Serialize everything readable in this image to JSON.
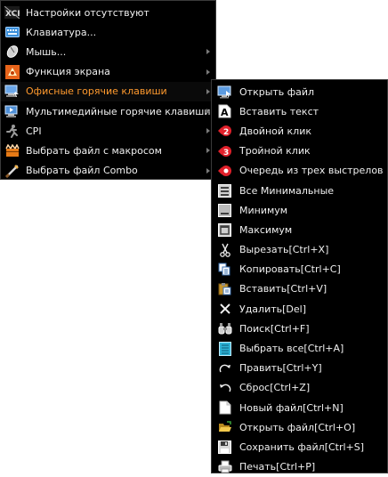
{
  "main_menu": {
    "items": [
      {
        "label": "Настройки отсутствуют",
        "icon": "no-config-icon",
        "submenu": false,
        "active": false
      },
      {
        "label": "Клавиатура...",
        "icon": "keyboard-icon",
        "submenu": false,
        "active": false
      },
      {
        "label": "Мышь...",
        "icon": "mouse-icon",
        "submenu": true,
        "active": false
      },
      {
        "label": "Функция экрана",
        "icon": "screen-function-icon",
        "submenu": true,
        "active": false
      },
      {
        "label": "Офисные горячие клавиши",
        "icon": "office-hotkeys-icon",
        "submenu": true,
        "active": true
      },
      {
        "label": "Мультимедийные горячие клавиши",
        "icon": "multimedia-hotkeys-icon",
        "submenu": true,
        "active": false
      },
      {
        "label": "CPI",
        "icon": "cpi-icon",
        "submenu": true,
        "active": false
      },
      {
        "label": "Выбрать файл с макросом",
        "icon": "macro-file-icon",
        "submenu": true,
        "active": false
      },
      {
        "label": "Выбрать файл Combo",
        "icon": "combo-file-icon",
        "submenu": true,
        "active": false
      }
    ]
  },
  "sub_menu": {
    "items": [
      {
        "label": "Открыть файл",
        "icon": "open-file-icon"
      },
      {
        "label": "Вставить текст",
        "icon": "insert-text-icon"
      },
      {
        "label": "Двойной клик",
        "icon": "double-click-icon"
      },
      {
        "label": "Тройной клик",
        "icon": "triple-click-icon"
      },
      {
        "label": "Очередь из трех выстрелов",
        "icon": "three-shot-burst-icon"
      },
      {
        "label": "Все Минимальные",
        "icon": "minimize-all-icon"
      },
      {
        "label": "Минимум",
        "icon": "minimize-icon"
      },
      {
        "label": "Максимум",
        "icon": "maximize-icon"
      },
      {
        "label": "Вырезать[Ctrl+X]",
        "icon": "cut-icon"
      },
      {
        "label": "Копировать[Ctrl+C]",
        "icon": "copy-icon"
      },
      {
        "label": "Вставить[Ctrl+V]",
        "icon": "paste-icon"
      },
      {
        "label": "Удалить[Del]",
        "icon": "delete-icon"
      },
      {
        "label": "Поиск[Ctrl+F]",
        "icon": "find-icon"
      },
      {
        "label": "Выбрать все[Ctrl+A]",
        "icon": "select-all-icon"
      },
      {
        "label": "Править[Ctrl+Y]",
        "icon": "redo-icon"
      },
      {
        "label": "Сброс[Ctrl+Z]",
        "icon": "undo-icon"
      },
      {
        "label": "Новый файл[Ctrl+N]",
        "icon": "new-file-icon"
      },
      {
        "label": "Открыть файл[Ctrl+O]",
        "icon": "open-folder-icon"
      },
      {
        "label": "Сохранить файл[Ctrl+S]",
        "icon": "save-file-icon"
      },
      {
        "label": "Печать[Ctrl+P]",
        "icon": "print-icon"
      }
    ]
  },
  "colors": {
    "menu_background": "#000000",
    "text": "#f0f0f0",
    "highlight_text": "#ff9a2e",
    "click_badge": "#e0202a"
  }
}
